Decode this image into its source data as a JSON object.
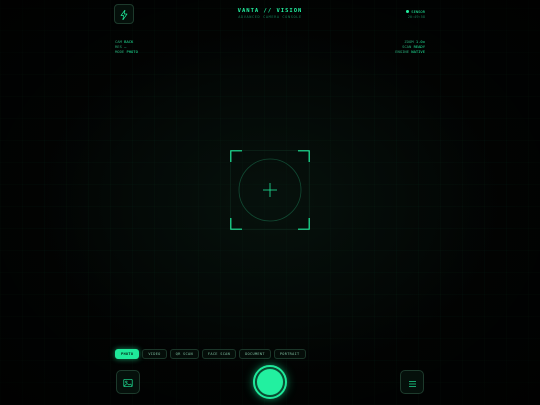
{
  "app": {
    "title": "VANTA // VISION",
    "subtitle": "ADVANCED CAMERA CONSOLE"
  },
  "status": {
    "label": "SENSOR",
    "time": "20:49:58"
  },
  "hud_left": [
    {
      "key": "CAM",
      "value": "BACK"
    },
    {
      "key": "RES",
      "value": "—"
    },
    {
      "key": "MODE",
      "value": "PHOTO"
    }
  ],
  "hud_right": [
    {
      "key": "ZOOM",
      "value": "1.0x"
    },
    {
      "key": "SCAN",
      "value": "READY"
    },
    {
      "key": "ENGINE",
      "value": "NATIVE"
    }
  ],
  "modes": [
    {
      "label": "PHOTO",
      "active": true
    },
    {
      "label": "VIDEO",
      "active": false
    },
    {
      "label": "QR SCAN",
      "active": false
    },
    {
      "label": "FACE SCAN",
      "active": false
    },
    {
      "label": "DOCUMENT",
      "active": false
    },
    {
      "label": "PORTRAIT",
      "active": false
    }
  ],
  "icons": {
    "flash": "flash-icon",
    "gallery": "gallery-icon",
    "menu": "menu-icon",
    "shutter": "shutter"
  },
  "colors": {
    "accent": "#1fe89a",
    "dim": "#157a55",
    "background": "#020403"
  }
}
